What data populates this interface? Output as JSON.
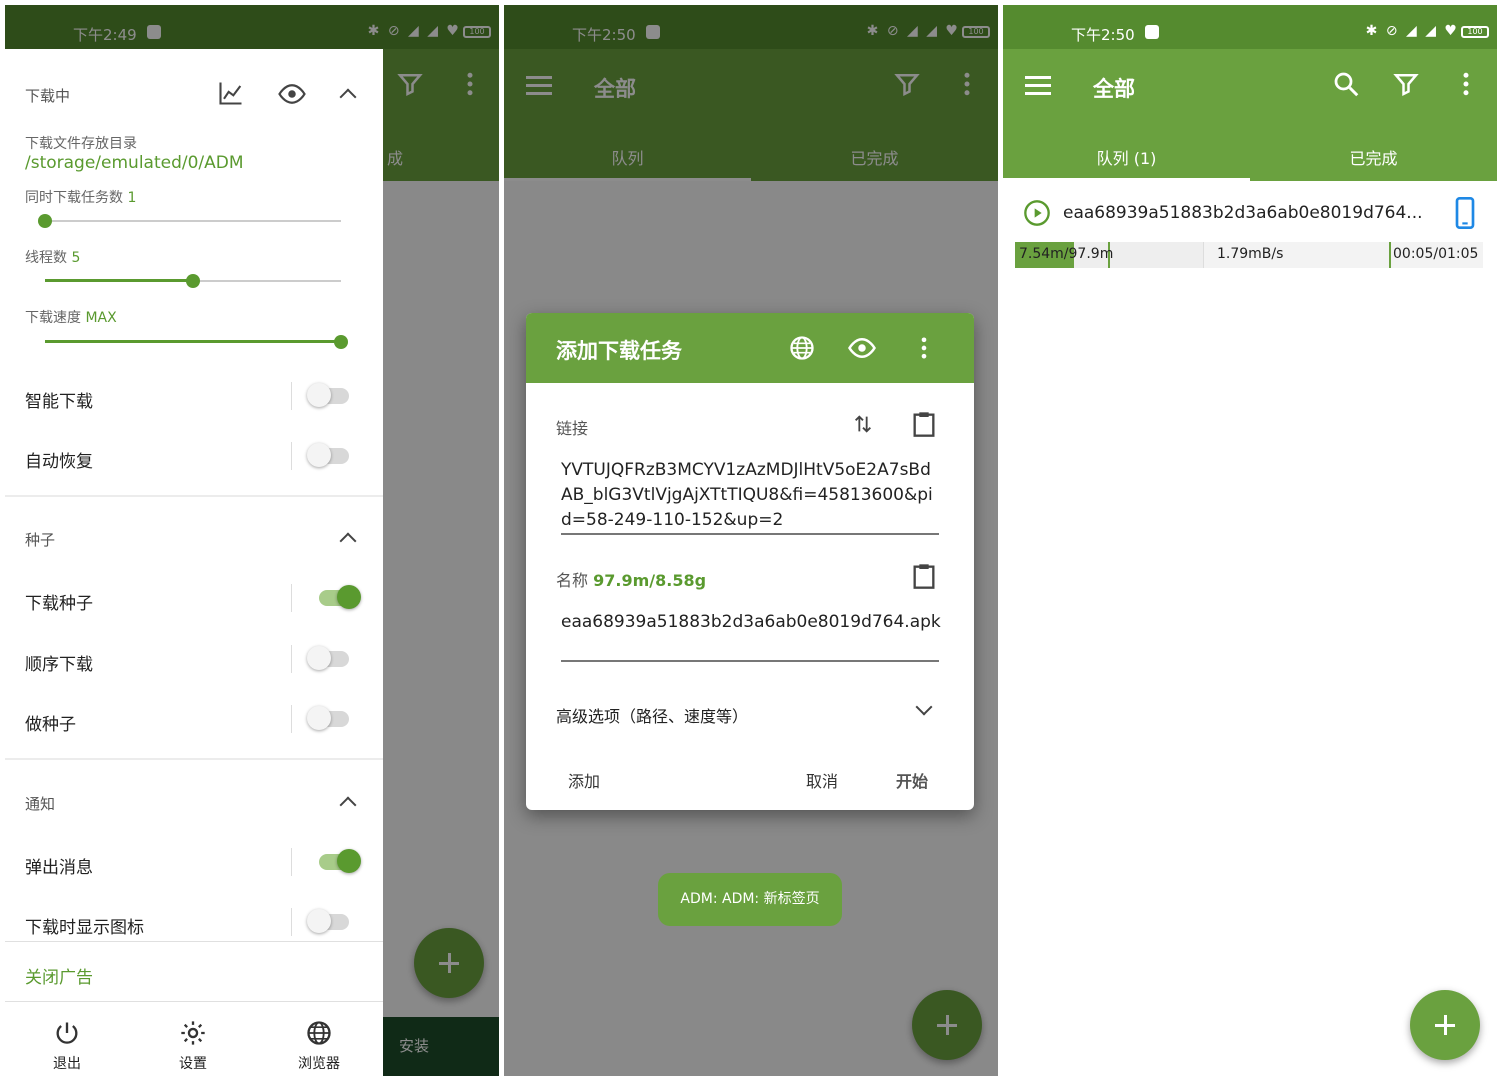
{
  "screen1": {
    "status_time": "下午2:49",
    "battery": "100",
    "behind_tab": "成",
    "behind_install": "安装",
    "downloading": {
      "title": "下载中",
      "dir_label": "下载文件存放目录",
      "dir_value": "/storage/emulated/0/ADM",
      "concurrent_label": "同时下载任务数",
      "concurrent_value": "1",
      "concurrent_level": 0,
      "threads_label": "线程数",
      "threads_value": "5",
      "threads_level": 0.5,
      "speed_label": "下载速度",
      "speed_value": "MAX",
      "speed_level": 1,
      "smart_label": "智能下载",
      "smart_on": false,
      "resume_label": "自动恢复",
      "resume_on": false
    },
    "torrent": {
      "title": "种子",
      "download_label": "下载种子",
      "download_on": true,
      "sequential_label": "顺序下载",
      "sequential_on": false,
      "seed_label": "做种子",
      "seed_on": false
    },
    "notify": {
      "title": "通知",
      "popup_label": "弹出消息",
      "popup_on": true,
      "icon_label": "下载时显示图标",
      "icon_on": false
    },
    "close_ads": "关闭广告",
    "nav": {
      "exit": "退出",
      "settings": "设置",
      "browser": "浏览器"
    }
  },
  "screen2": {
    "status_time": "下午2:50",
    "battery": "100",
    "appbar_title": "全部",
    "tab_queue": "队列",
    "tab_done": "已完成",
    "dialog": {
      "title": "添加下载任务",
      "link_label": "链接",
      "link_value": "YVTUJQFRzB3MCYV1zAzMDJlHtV5oE2A7sBdAB_blG3VtlVjgAjXTtTIQU8&fi=45813600&pid=58-249-110-152&up=2",
      "name_label": "名称",
      "name_size": "97.9m/8.58g",
      "name_value": "eaa68939a51883b2d3a6ab0e8019d764.apk",
      "advanced": "高级选项（路径、速度等）",
      "btn_add": "添加",
      "btn_cancel": "取消",
      "btn_start": "开始"
    },
    "toast": "ADM: ADM: 新标签页"
  },
  "screen3": {
    "status_time": "下午2:50",
    "battery": "100",
    "appbar_title": "全部",
    "tab_queue": "队列 (1)",
    "tab_done": "已完成",
    "item": {
      "filename": "eaa68939a51883b2d3a6ab0e8019d764...",
      "progress_text": "7.54m/97.9m",
      "progress": 0.077,
      "speed": "1.79mB/s",
      "time": "00:05/01:05"
    }
  },
  "colors": {
    "primary": "#6aa13f",
    "statusbar": "#558b2f",
    "accent_text": "#5a9a2f"
  }
}
